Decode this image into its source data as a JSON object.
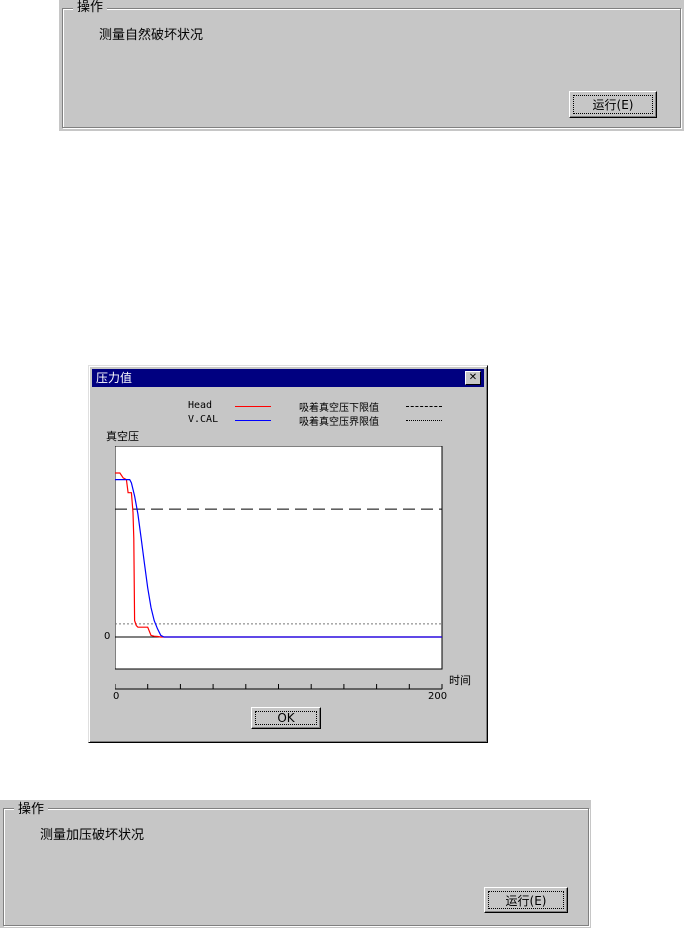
{
  "top_group": {
    "legend": "操作",
    "text": "测量自然破坏状况",
    "run_button": "运行(E)"
  },
  "dialog": {
    "title": "压力值",
    "close_symbol": "✕",
    "legend": {
      "head": "Head",
      "vcal": "V.CAL",
      "lower_limit": "吸着真空压下限值",
      "boundary_limit": "吸着真空压界限值"
    },
    "y_axis_label": "真空压",
    "x_axis_label": "时间",
    "y_zero_label": "0",
    "x_start_label": "0",
    "x_end_label": "200",
    "ok_button": "OK",
    "colors": {
      "head": "#ff0000",
      "vcal": "#0000ff",
      "limit": "#000000"
    }
  },
  "bottom_group": {
    "legend": "操作",
    "text": "测量加压破坏状况",
    "run_button": "运行(E)"
  },
  "chart_data": {
    "type": "line",
    "xlabel": "时间",
    "ylabel": "真空压",
    "xlim": [
      0,
      200
    ],
    "series": [
      {
        "name": "Head",
        "x": [
          0,
          3,
          5,
          7,
          8,
          10,
          11,
          11.5,
          12,
          13,
          14,
          20,
          22,
          24,
          26,
          28,
          40,
          60,
          100,
          150,
          200
        ],
        "y": [
          100,
          100,
          97,
          96,
          88,
          88,
          76,
          60,
          10,
          7,
          6,
          6,
          1,
          0.5,
          0.3,
          0,
          0,
          0,
          0,
          0,
          0
        ]
      },
      {
        "name": "V.CAL",
        "x": [
          0,
          4,
          8,
          9,
          10,
          12,
          14,
          16,
          18,
          20,
          22,
          24,
          26,
          28,
          30,
          60,
          100,
          150,
          200
        ],
        "y": [
          96,
          96,
          96,
          96,
          94,
          86,
          75,
          60,
          45,
          30,
          18,
          10,
          5,
          1,
          0,
          0,
          0,
          0,
          0
        ]
      }
    ],
    "lower_limit": 78,
    "boundary_limit": 8
  }
}
